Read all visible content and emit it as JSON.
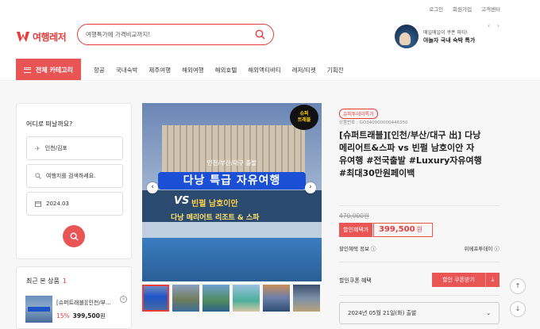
{
  "util_links": [
    "로그인",
    "회원가입",
    "고객센터"
  ],
  "logo": {
    "text": "여행레저",
    "color": "#e63c3c"
  },
  "search": {
    "placeholder": "여행특가에 가격비교까지!",
    "icon": "search-icon"
  },
  "promo": {
    "subtitle": "매일매일이 쿠폰 파티!",
    "title": "야놀자 국내 숙박 특가",
    "arrows": "‹ ›"
  },
  "nav": {
    "category_button": "전체 카테고리",
    "items": [
      "항공",
      "국내숙박",
      "제주여행",
      "해외여행",
      "해외호텔",
      "해외액티비티",
      "레저/티켓",
      "기획전"
    ]
  },
  "sidebar": {
    "title": "어디로 떠날까요?",
    "departure": "인천/김포",
    "destination_placeholder": "여행지를 검색하세요.",
    "date": "2024.03",
    "search_icon": "search-icon"
  },
  "recent": {
    "title": "최근 본 상품",
    "count": "1",
    "item_name": "[슈퍼트래블][인천/부...",
    "discount": "15%",
    "price": "399,500",
    "unit": "원"
  },
  "gallery": {
    "badge_line1": "슈퍼",
    "badge_line2": "트래블",
    "top_text": "인천/부산/대구 출발",
    "banner": "다낭 특급 자유여행",
    "vs": "VS",
    "line1": "빈펄 남호이안",
    "line2": "다낭 메리어트 리조트 & 스파",
    "prev": "‹",
    "next": "›"
  },
  "product": {
    "tag": "슈퍼투데이특가",
    "code": "상품번호 : GO340000000446350",
    "title": "[슈퍼트래블][인천/부산/대구 出] 다낭 메리어트&스파 vs 빈펄 남호이안 자유여행 #전국출발 #Luxury자유여행 #최대30만원페이백",
    "original_price": "470,000원",
    "discount_label": "할인혜택가",
    "price": "399,500",
    "price_unit": "원",
    "discount_info": "할인혜택 정보",
    "smile_pay": "위메프투데이",
    "coupon_label": "할인쿠폰 혜택",
    "coupon_button": "할인 쿠폰받기",
    "date_select": "2024년 05월 21일(화) 출발"
  },
  "float": {
    "up": "↑",
    "down": "↓"
  }
}
